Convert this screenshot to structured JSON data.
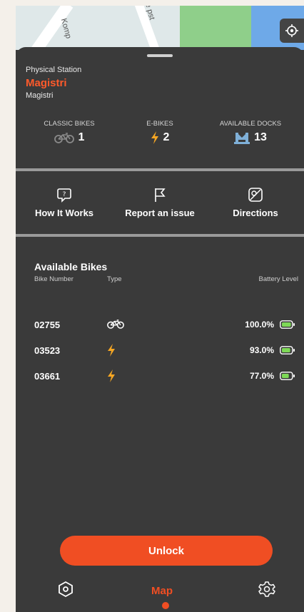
{
  "map": {
    "labels": [
      "Komp",
      "e pst"
    ]
  },
  "station": {
    "type_label": "Physical Station",
    "name": "Magistri",
    "subtitle": "Magistri"
  },
  "stats": {
    "classic_label": "CLASSIC BIKES",
    "classic_value": "1",
    "ebikes_label": "E-BIKES",
    "ebikes_value": "2",
    "docks_label": "AVAILABLE DOCKS",
    "docks_value": "13"
  },
  "actions": {
    "how_it_works": "How It Works",
    "report_issue": "Report an issue",
    "directions": "Directions"
  },
  "bikes": {
    "title": "Available Bikes",
    "col_number": "Bike Number",
    "col_type": "Type",
    "col_battery": "Battery Level",
    "rows": [
      {
        "number": "02755",
        "type": "bicycle-icon",
        "battery": "100.0%",
        "battery_fraction": 1.0
      },
      {
        "number": "03523",
        "type": "lightning-icon",
        "battery": "93.0%",
        "battery_fraction": 0.93
      },
      {
        "number": "03661",
        "type": "lightning-icon",
        "battery": "77.0%",
        "battery_fraction": 0.77
      }
    ]
  },
  "unlock_label": "Unlock",
  "tabbar": {
    "map_label": "Map"
  },
  "colors": {
    "accent": "#f04e23",
    "station_name": "#ff5a2b",
    "lightning": "#f5a623",
    "battery": "#7ed957",
    "dock": "#7fb0d8"
  }
}
